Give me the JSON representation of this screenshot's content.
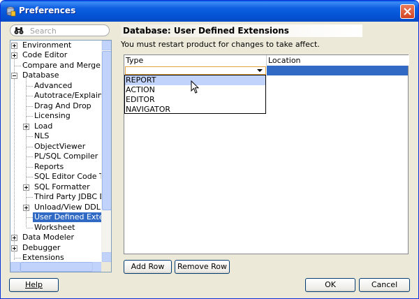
{
  "window": {
    "title": "Preferences"
  },
  "search": {
    "placeholder": "Search"
  },
  "tree": {
    "items": [
      {
        "label": "Environment",
        "expandable": true
      },
      {
        "label": "Code Editor",
        "expandable": true
      },
      {
        "label": "Compare and Merge",
        "expandable": false
      },
      {
        "label": "Database",
        "expandable": true,
        "expanded": true
      },
      {
        "label": "Advanced",
        "expandable": false
      },
      {
        "label": "Autotrace/Explain Plan",
        "expandable": false
      },
      {
        "label": "Drag And Drop",
        "expandable": false
      },
      {
        "label": "Licensing",
        "expandable": false
      },
      {
        "label": "Load",
        "expandable": true
      },
      {
        "label": "NLS",
        "expandable": false
      },
      {
        "label": "ObjectViewer",
        "expandable": false
      },
      {
        "label": "PL/SQL Compiler",
        "expandable": false
      },
      {
        "label": "Reports",
        "expandable": false
      },
      {
        "label": "SQL Editor Code Templa",
        "expandable": false
      },
      {
        "label": "SQL Formatter",
        "expandable": true
      },
      {
        "label": "Third Party JDBC Driver",
        "expandable": false
      },
      {
        "label": "Unload/View DDL Optior",
        "expandable": true
      },
      {
        "label": "User Defined Extension",
        "expandable": false,
        "selected": true
      },
      {
        "label": "Worksheet",
        "expandable": false
      },
      {
        "label": "Data Modeler",
        "expandable": true
      },
      {
        "label": "Debugger",
        "expandable": true
      },
      {
        "label": "Extensions",
        "expandable": false
      }
    ]
  },
  "page": {
    "title": "Database: User Defined Extensions",
    "info": "You must restart product for changes to take affect."
  },
  "table": {
    "columns": [
      "Type",
      "Location"
    ],
    "type_value": ""
  },
  "dropdown": {
    "options": [
      "REPORT",
      "ACTION",
      "EDITOR",
      "NAVIGATOR"
    ],
    "highlighted": "REPORT"
  },
  "buttons": {
    "add_row": "Add Row",
    "remove_row": "Remove Row",
    "help": "Help",
    "ok": "OK",
    "cancel": "Cancel"
  },
  "colors": {
    "selection": "#316ac5",
    "titlebar": "#0554d6",
    "dialog_bg": "#ece9d8"
  }
}
